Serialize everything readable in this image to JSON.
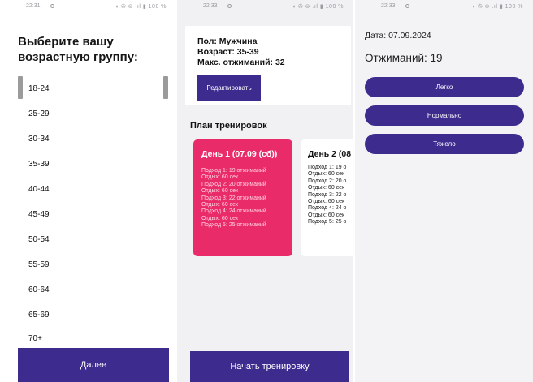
{
  "colors": {
    "primary": "#3d2b8e",
    "day_card": "#ea2b69"
  },
  "screen1": {
    "status_time": "22:31",
    "status_icons": "◖ ✇ ⊜ .ıl ▮ 100 %",
    "title": "Выберите вашу возрастную группу:",
    "age_groups": [
      "18-24",
      "25-29",
      "30-34",
      "35-39",
      "40-44",
      "45-49",
      "50-54",
      "55-59",
      "60-64",
      "65-69",
      "70+"
    ],
    "next_label": "Далее"
  },
  "screen2": {
    "status_time": "22:33",
    "status_icons": "◖ ✇ ⊜ .ıl ▮ 100 %",
    "gender": "Пол: Мужчина",
    "age": "Возраст: 35-39",
    "max_pushups": "Макс. отжиманий: 32",
    "edit_label": "Редактировать",
    "plan_title": "План тренировок",
    "day1": {
      "title": "День 1 (07.09 (сб))",
      "lines": [
        "Подход 1: 19 отжиманий",
        "Отдых: 60 сек",
        "Подход 2: 20 отжиманий",
        "Отдых: 60 сек",
        "Подход 3: 22 отжиманий",
        "Отдых: 60 сек",
        "Подход 4: 24 отжиманий",
        "Отдых: 60 сек",
        "Подход 5: 25 отжиманий"
      ]
    },
    "day2": {
      "title": "День 2 (08",
      "lines": [
        "Подход 1: 19 о",
        "Отдых: 60 сек",
        "Подход 2: 20 о",
        "Отдых: 60 сек",
        "Подход 3: 22 о",
        "Отдых: 60 сек",
        "Подход 4: 24 о",
        "Отдых: 60 сек",
        "Подход 5: 25 о"
      ]
    },
    "start_label": "Начать тренировку"
  },
  "screen3": {
    "status_time": "22:33",
    "status_icons": "◖ ✇ ⊜ .ıl ▮ 100 %",
    "date": "Дата: 07.09.2024",
    "pushups": "Отжиманий: 19",
    "difficulty": [
      "Легко",
      "Нормально",
      "Тяжело"
    ]
  }
}
